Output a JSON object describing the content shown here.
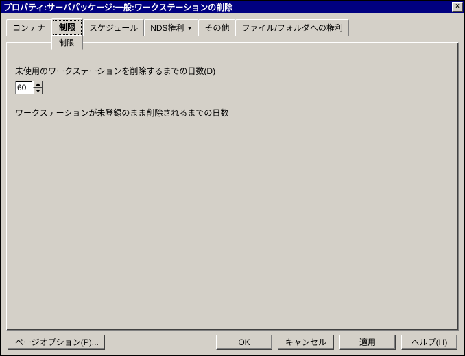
{
  "window": {
    "title": "プロパティ:サーバパッケージ:一般:ワークステーションの削除",
    "close_glyph": "×"
  },
  "tabs": {
    "container": "コンテナ",
    "limit_top": "制限",
    "limit_bottom": "制限",
    "schedule": "スケジュール",
    "nds_rights": "NDS権利",
    "other": "その他",
    "file_folder_rights": "ファイル/フォルダへの権利"
  },
  "panel": {
    "days_label_prefix": "未使用のワークステーションを削除するまでの日数(",
    "days_label_mn": "D",
    "days_label_suffix": ")",
    "days_value": "60",
    "description": "ワークステーションが未登録のまま削除されるまでの日数"
  },
  "footer": {
    "page_options_prefix": "ページオプション(",
    "page_options_mn": "P",
    "page_options_suffix": ")...",
    "ok": "OK",
    "cancel": "キャンセル",
    "apply": "適用",
    "help_prefix": "ヘルプ(",
    "help_mn": "H",
    "help_suffix": ")"
  }
}
